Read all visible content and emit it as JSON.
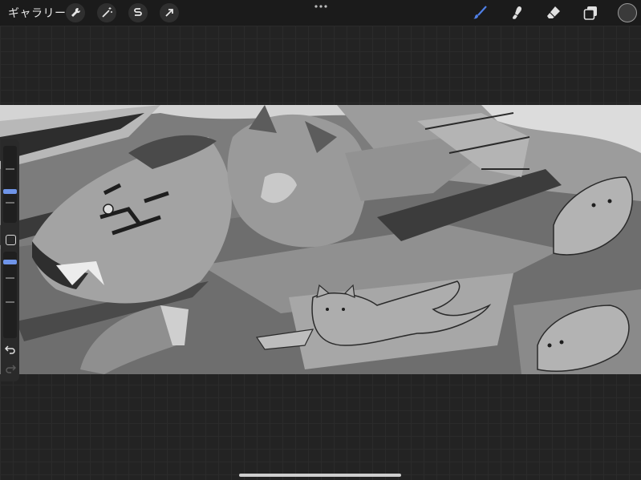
{
  "app": {
    "gallery_label": "ギャラリー"
  },
  "toolbar_left": [
    {
      "name": "wrench-icon"
    },
    {
      "name": "magic-wand-icon"
    },
    {
      "name": "selection-s-icon"
    },
    {
      "name": "transform-arrow-icon"
    }
  ],
  "toolbar_right": [
    {
      "name": "brush-icon",
      "active": true
    },
    {
      "name": "smudge-icon",
      "active": false
    },
    {
      "name": "eraser-icon",
      "active": false
    },
    {
      "name": "layers-icon",
      "active": false
    }
  ],
  "colors": {
    "active_tool": "#4f7fe6",
    "current_color": "#3a3a3a"
  },
  "sidebar": {
    "brush_size_level": 0.4,
    "opacity_level": 0.25
  }
}
